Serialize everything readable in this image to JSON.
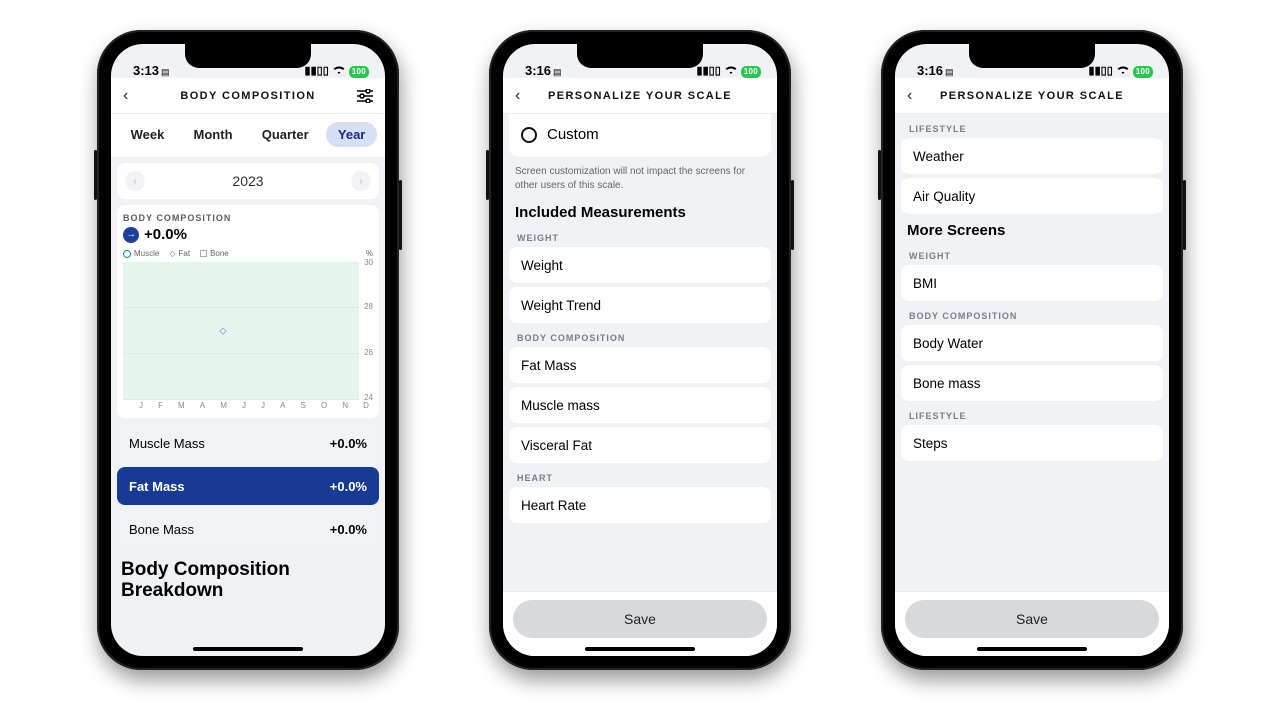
{
  "status": {
    "time_a": "3:13",
    "time_b": "3:16",
    "time_c": "3:16",
    "batt": "100"
  },
  "a": {
    "title": "BODY COMPOSITION",
    "tabs": [
      "Week",
      "Month",
      "Quarter",
      "Year"
    ],
    "active_tab": 3,
    "year": "2023",
    "section_label": "BODY COMPOSITION",
    "total_delta": "+0.0%",
    "legend": {
      "muscle": "Muscle",
      "fat": "Fat",
      "bone": "Bone",
      "pct": "%"
    },
    "rows": [
      {
        "label": "Muscle Mass",
        "value": "+0.0%"
      },
      {
        "label": "Fat Mass",
        "value": "+0.0%"
      },
      {
        "label": "Bone Mass",
        "value": "+0.0%"
      }
    ],
    "selected_row": 1,
    "breakdown_title": "Body Composition Breakdown"
  },
  "b": {
    "title": "PERSONALIZE YOUR SCALE",
    "custom": "Custom",
    "caption": "Screen customization will not impact the screens for other users of this scale.",
    "section": "Included Measurements",
    "groups": [
      {
        "label": "WEIGHT",
        "items": [
          "Weight",
          "Weight Trend"
        ]
      },
      {
        "label": "BODY COMPOSITION",
        "items": [
          "Fat Mass",
          "Muscle mass",
          "Visceral Fat"
        ]
      },
      {
        "label": "HEART",
        "items": [
          "Heart Rate"
        ]
      }
    ],
    "save": "Save"
  },
  "c": {
    "title": "PERSONALIZE YOUR SCALE",
    "lifestyle_lbl": "LIFESTYLE",
    "lifestyle": [
      "Weather",
      "Air Quality"
    ],
    "section": "More Screens",
    "groups": [
      {
        "label": "WEIGHT",
        "items": [
          "BMI"
        ]
      },
      {
        "label": "BODY COMPOSITION",
        "items": [
          "Body Water",
          "Bone mass"
        ]
      },
      {
        "label": "LIFESTYLE",
        "items": [
          "Steps"
        ]
      }
    ],
    "save": "Save"
  },
  "chart_data": {
    "type": "line",
    "title": "Body Composition",
    "ylabel": "%",
    "ylim": [
      24,
      30
    ],
    "yticks": [
      24,
      26,
      28,
      30
    ],
    "categories": [
      "J",
      "F",
      "M",
      "A",
      "M",
      "J",
      "J",
      "A",
      "S",
      "O",
      "N",
      "D"
    ],
    "series": [
      {
        "name": "Muscle",
        "values": [
          null,
          null,
          null,
          null,
          null,
          null,
          null,
          null,
          null,
          null,
          null,
          null
        ]
      },
      {
        "name": "Fat",
        "values": [
          null,
          null,
          null,
          null,
          27,
          null,
          null,
          null,
          null,
          null,
          null,
          null
        ]
      },
      {
        "name": "Bone",
        "values": [
          null,
          null,
          null,
          null,
          null,
          null,
          null,
          null,
          null,
          null,
          null,
          null
        ]
      }
    ]
  }
}
